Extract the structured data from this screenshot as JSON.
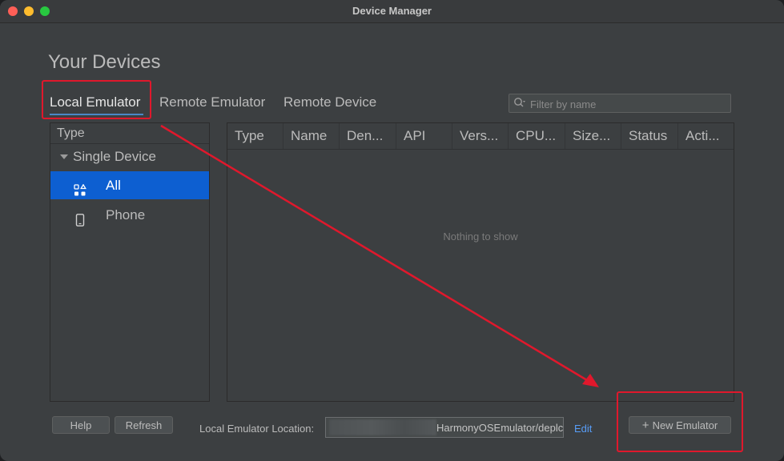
{
  "window": {
    "title": "Device Manager"
  },
  "page": {
    "heading": "Your Devices"
  },
  "tabs": [
    {
      "label": "Local Emulator",
      "active": true
    },
    {
      "label": "Remote Emulator",
      "active": false
    },
    {
      "label": "Remote Device",
      "active": false
    }
  ],
  "filter": {
    "placeholder": "Filter by name",
    "icon": "search-icon"
  },
  "sidebar": {
    "header": "Type",
    "group": {
      "label": "Single Device",
      "expanded": true
    },
    "items": [
      {
        "label": "All",
        "icon": "grid-shapes-icon",
        "selected": true
      },
      {
        "label": "Phone",
        "icon": "phone-icon",
        "selected": false
      }
    ]
  },
  "table": {
    "columns": [
      "Type",
      "Name",
      "Den...",
      "API",
      "Vers...",
      "CPU...",
      "Size...",
      "Status",
      "Acti..."
    ],
    "empty_text": "Nothing to show"
  },
  "footer": {
    "help_label": "Help",
    "refresh_label": "Refresh",
    "location_label": "Local Emulator Location:",
    "location_value": "HarmonyOSEmulator/deplc",
    "edit_label": "Edit",
    "new_emulator_label": "New Emulator"
  },
  "colors": {
    "accent": "#0d5fd1",
    "link": "#589df6",
    "annotation": "#e0182c",
    "background": "#3c3f41"
  }
}
